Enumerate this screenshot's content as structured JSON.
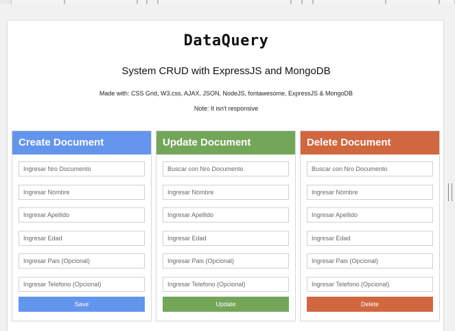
{
  "app": {
    "logo": "DataQuery",
    "subtitle": "System CRUD with ExpressJS and MongoDB",
    "made_with": "Made with: CSS Grid, W3.css, AJAX, JSON, NodeJS, fontawesome, ExpressJS & MongoDB",
    "note": "Note: It isn't responsive"
  },
  "colors": {
    "create": "#6495ed",
    "update": "#74a65a",
    "delete": "#d0673f"
  },
  "panels": [
    {
      "title": "Create Document",
      "fields": [
        "Ingresar Nro Documento",
        "Ingresar Nombre",
        "Ingresar Apellido",
        "Ingresar Edad",
        "Ingresar Pais (Opcional)",
        "Ingresar Telefono (Opcional)"
      ],
      "button": "Save"
    },
    {
      "title": "Update Document",
      "fields": [
        "Buscar con Nro Documento",
        "Ingresar Nombre",
        "Ingresar Apellido",
        "Ingresar Edad",
        "Ingresar Pais (Opcional)",
        "Ingresar Telefono (Opcional)"
      ],
      "button": "Update"
    },
    {
      "title": "Delete Document",
      "fields": [
        "Buscar con Nro Documento",
        "Ingresar Nombre",
        "Ingresar Apellido",
        "Ingresar Edad",
        "Ingresar Pais (Opcional)",
        "Ingresar Telefono (Opcional)"
      ],
      "button": "Delete"
    }
  ]
}
